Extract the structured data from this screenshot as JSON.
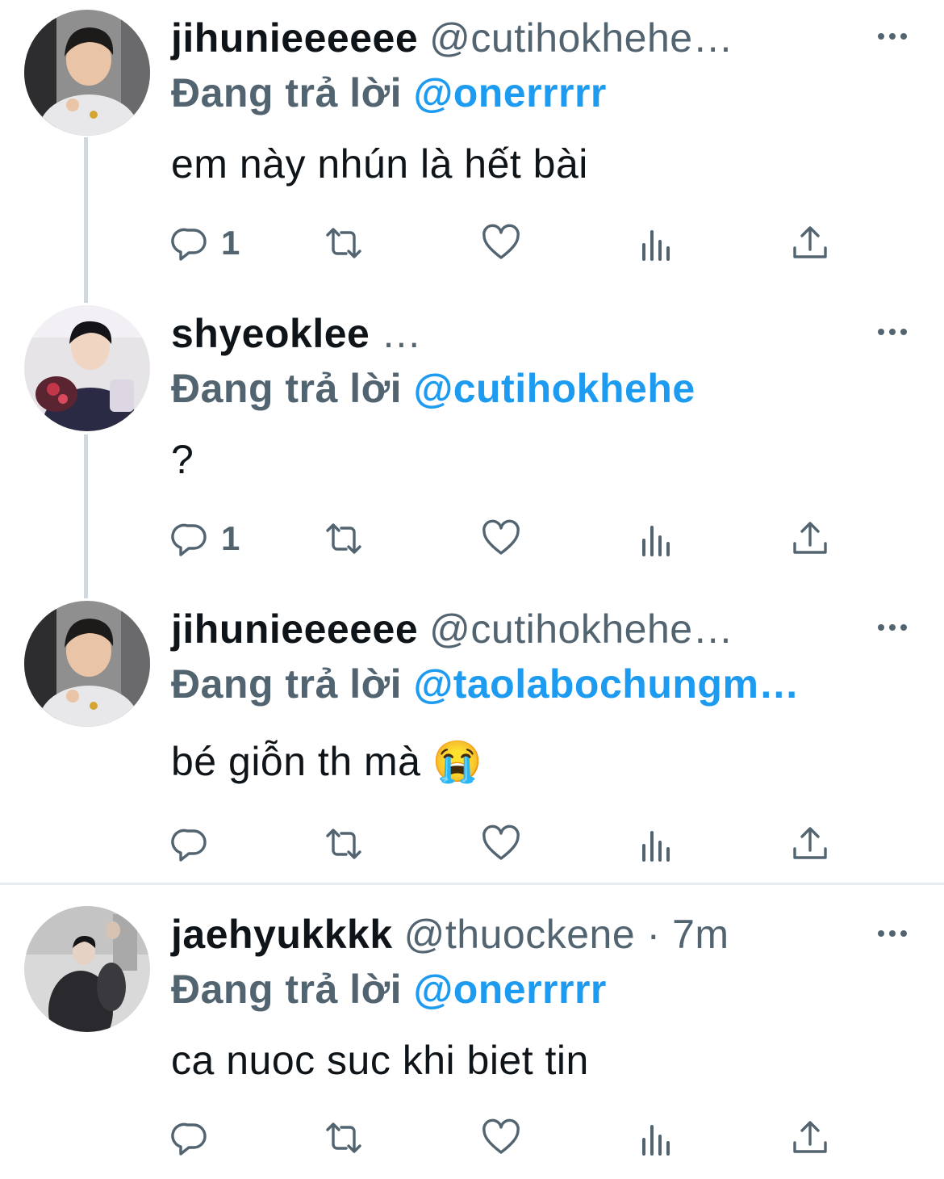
{
  "tweets": [
    {
      "name": "jihunieeeeee",
      "handle": "@cutihokhehe…",
      "reply_prefix": "Đang trả lời",
      "reply_to": "@onerrrrr",
      "text": "em này nhún là hết bài",
      "reply_count": "1",
      "avatar": "avatar-jihun"
    },
    {
      "name": "shyeoklee",
      "handle": "…",
      "reply_prefix": "Đang trả lời",
      "reply_to": "@cutihokhehe",
      "text": "?",
      "reply_count": "1",
      "avatar": "avatar-shyeoklee"
    },
    {
      "name": "jihunieeeeee",
      "handle": "@cutihokhehe…",
      "reply_prefix": "Đang trả lời",
      "reply_to": "@taolabochungm…",
      "text": "bé giỗn th mà 😭",
      "reply_count": "",
      "avatar": "avatar-jihun"
    },
    {
      "name": "jaehyukkkk",
      "handle": "@thuockene · 7m",
      "reply_prefix": "Đang trả lời",
      "reply_to": "@onerrrrr",
      "text": "ca nuoc suc khi biet tin",
      "reply_count": "",
      "avatar": "avatar-jaehyuk"
    }
  ],
  "icons": {
    "reply": "reply-icon",
    "retweet": "retweet-icon",
    "like": "heart-icon",
    "views": "analytics-icon",
    "share": "share-icon",
    "more": "more-icon"
  },
  "colors": {
    "accent": "#1d9bf0",
    "secondary_text": "#536471",
    "thread_line": "#cfd9de"
  }
}
